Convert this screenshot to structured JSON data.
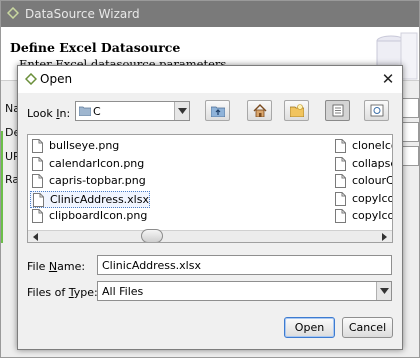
{
  "wizard": {
    "title": "DataSource Wizard",
    "heading": "Define Excel Datasource",
    "subheading": "Enter Excel datasource parameters",
    "side_labels": [
      "Na",
      "De",
      "UR",
      "Ra"
    ]
  },
  "dialog": {
    "title": "Open",
    "look_in_label_pre": "Look ",
    "look_in_label_key": "I",
    "look_in_label_post": "n:",
    "look_in_value": "C",
    "files_col1": [
      "bullseye.png",
      "calendarIcon.png",
      "capris-topbar.png",
      "ClinicAddress.xlsx",
      "clipboardIcon.png"
    ],
    "files_col2": [
      "cloneIcon",
      "collapseI",
      "colourCh",
      "copyIcon",
      "copyIcon"
    ],
    "selected_index": 3,
    "file_name_label_pre": "File ",
    "file_name_label_key": "N",
    "file_name_label_post": "ame:",
    "file_name_value": "ClinicAddress.xlsx",
    "files_of_type_label_pre": "Files of ",
    "files_of_type_label_key": "T",
    "files_of_type_label_post": "ype:",
    "files_of_type_value": "All Files",
    "open_button": "Open",
    "cancel_button": "Cancel"
  },
  "colors": {
    "selection_border": "#4c7fc7",
    "default_button_border": "#3d7bd0"
  }
}
